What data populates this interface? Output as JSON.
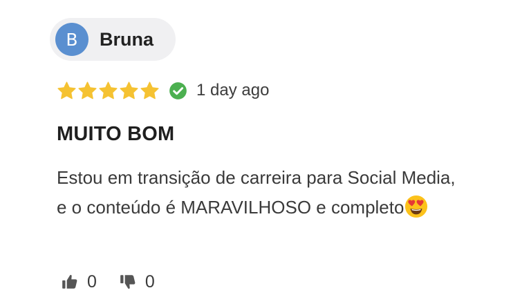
{
  "author": {
    "initial": "B",
    "name": "Bruna",
    "avatar_color": "#5a8fd0"
  },
  "rating": {
    "stars": 5,
    "max": 5,
    "star_color": "#f5c232",
    "verified_icon": "check-circle-icon",
    "verified_color": "#4cb050",
    "date": "1 day ago"
  },
  "review": {
    "title": "MUITO BOM",
    "body": "Estou em transição de carreira para Social Media, e o conteúdo é MARAVILHOSO e completo",
    "emoji": "heart-eyes-emoji"
  },
  "votes": {
    "up_count": "0",
    "down_count": "0",
    "up_icon": "thumbs-up-icon",
    "down_icon": "thumbs-down-icon"
  }
}
